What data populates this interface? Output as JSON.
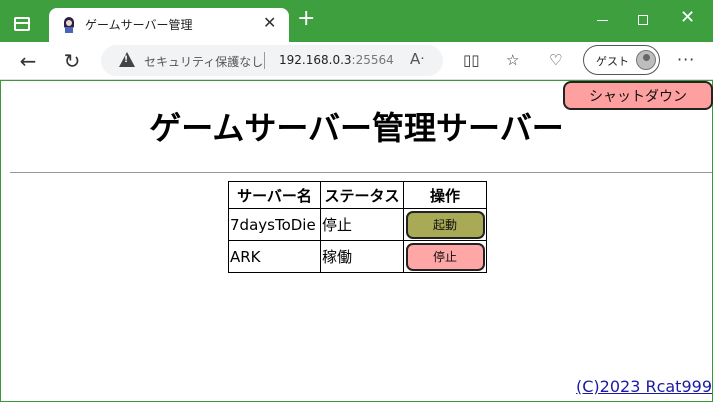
{
  "browser": {
    "tab_title": "ゲームサーバー管理",
    "tab_close": "✕",
    "new_tab": "+",
    "address": {
      "security_label": "セキュリティ保護なし",
      "host": "192.168.0.3",
      "port": ":25564"
    },
    "guest_label": "ゲスト",
    "colors": {
      "accent": "#3e9f3e"
    }
  },
  "page": {
    "shutdown_label": "シャットダウン",
    "title": "ゲームサーバー管理サーバー",
    "table": {
      "headers": [
        "サーバー名",
        "ステータス",
        "操作"
      ],
      "rows": [
        {
          "name": "7daysToDie",
          "status": "停止",
          "action": "起動",
          "action_color": "#a8aa55"
        },
        {
          "name": "ARK",
          "status": "稼働",
          "action": "停止",
          "action_color": "#ffa6a6"
        }
      ]
    },
    "footer": "(C)2023 Rcat999"
  }
}
